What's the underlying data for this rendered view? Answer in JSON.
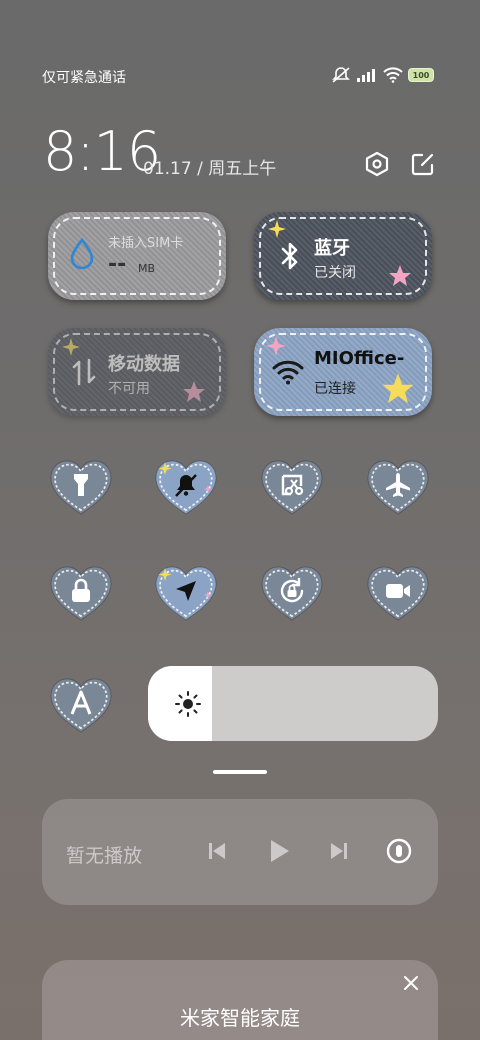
{
  "status_bar": {
    "carrier": "仅可紧急通话",
    "battery": "100",
    "icons": [
      "mute-icon",
      "signal-icon",
      "wifi-icon",
      "battery-icon"
    ]
  },
  "header": {
    "time": "8:16",
    "date": "01.17 / 周五上午",
    "icons": [
      "settings-icon",
      "edit-icon"
    ]
  },
  "cards": {
    "sim": {
      "title": "未插入SIM卡",
      "value": "--",
      "unit": "MB"
    },
    "bluetooth": {
      "title": "蓝牙",
      "status": "已关闭"
    },
    "mobile_data": {
      "title": "移动数据",
      "status": "不可用"
    },
    "wifi": {
      "title": "MIOffice-",
      "status": "已连接"
    }
  },
  "toggles": [
    {
      "icon": "flashlight-icon",
      "active": false
    },
    {
      "icon": "silent-bell-icon",
      "active": true
    },
    {
      "icon": "screenshot-icon",
      "active": false
    },
    {
      "icon": "airplane-icon",
      "active": false
    },
    {
      "icon": "lock-icon",
      "active": false
    },
    {
      "icon": "location-icon",
      "active": true
    },
    {
      "icon": "auto-rotate-icon",
      "active": false
    },
    {
      "icon": "video-camera-icon",
      "active": false
    },
    {
      "icon": "font-size-icon",
      "active": false
    }
  ],
  "brightness": {
    "level": 0.22,
    "icon": "sun-icon"
  },
  "media": {
    "status": "暂无播放",
    "controls": [
      "previous-icon",
      "play-icon",
      "next-icon",
      "cast-icon"
    ]
  },
  "smart_home": {
    "title": "米家智能家庭",
    "close_icon": "close-icon"
  },
  "colors": {
    "denim_blue": "#8ba3c4",
    "denim_dark": "#4f5560",
    "star_yellow": "#f7dc5a",
    "star_pink": "#f2a6c3"
  }
}
